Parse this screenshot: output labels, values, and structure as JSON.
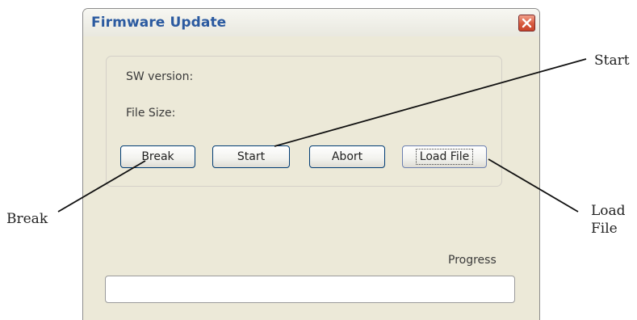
{
  "window": {
    "title": "Firmware Update",
    "close_icon": "close-icon"
  },
  "group": {
    "sw_version_label": "SW version:",
    "file_size_label": "File Size:"
  },
  "buttons": {
    "break": "Break",
    "start": "Start",
    "abort": "Abort",
    "load_file": "Load File"
  },
  "progress": {
    "label": "Progress",
    "value": 0
  },
  "callouts": {
    "start": "Start",
    "break": "Break",
    "load_line1": "Load",
    "load_line2": "File"
  },
  "colors": {
    "title": "#2b5aa0",
    "window_bg": "#ece9d8",
    "close_button": "#d75a3e"
  }
}
